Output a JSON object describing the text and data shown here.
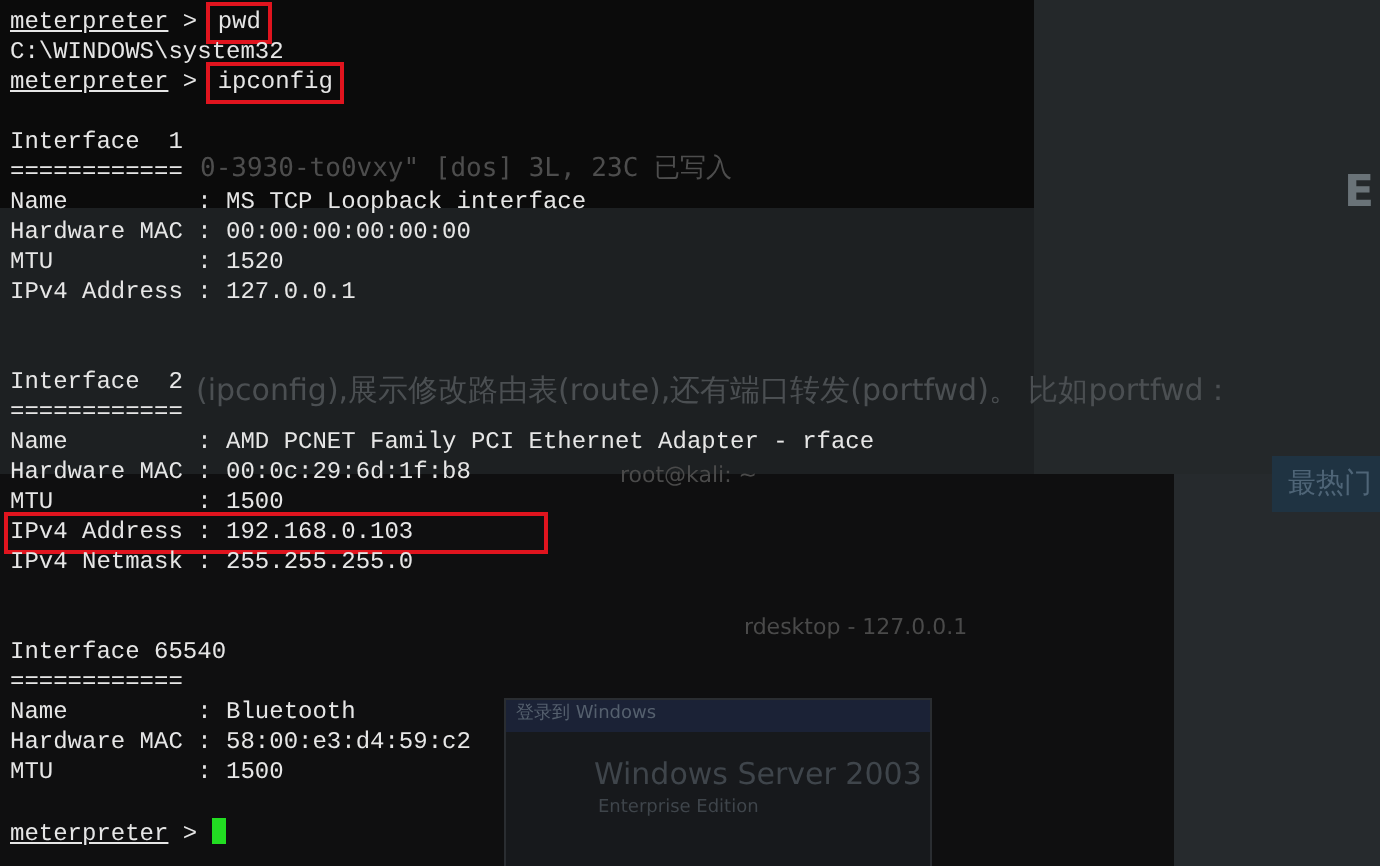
{
  "background": {
    "vim_status": "0-3930-to0vxy\" [dos] 3L, 23C 已写入",
    "side_letter": "E",
    "article_text": "(ipconfig),展示修改路由表(route),还有端口转发(portfwd)。 比如portfwd：",
    "side_button": "最热门",
    "terminal_title": "root@kali: ~",
    "rdesktop_title": "rdesktop - 127.0.0.1",
    "dialog_title": "登录到 Windows",
    "dialog_product": "Windows Server 2003",
    "dialog_edition": "Enterprise Edition"
  },
  "terminal": {
    "lines": [
      {
        "kind": "prompt",
        "prompt": "meterpreter",
        "separator": ">",
        "command": "pwd",
        "highlighted": true
      },
      {
        "kind": "output",
        "text": "C:\\WINDOWS\\system32",
        "highlighted": false
      },
      {
        "kind": "prompt",
        "prompt": "meterpreter",
        "separator": ">",
        "command": "ipconfig",
        "highlighted": true
      },
      {
        "kind": "blank"
      },
      {
        "kind": "output",
        "text": "Interface  1",
        "highlighted": false
      },
      {
        "kind": "output",
        "text": "============",
        "highlighted": false
      },
      {
        "kind": "output",
        "text": "Name         : MS TCP Loopback interface",
        "highlighted": false
      },
      {
        "kind": "output",
        "text": "Hardware MAC : 00:00:00:00:00:00",
        "highlighted": false
      },
      {
        "kind": "output",
        "text": "MTU          : 1520",
        "highlighted": false
      },
      {
        "kind": "output",
        "text": "IPv4 Address : 127.0.0.1",
        "highlighted": false
      },
      {
        "kind": "blank"
      },
      {
        "kind": "blank"
      },
      {
        "kind": "output",
        "text": "Interface  2",
        "highlighted": false
      },
      {
        "kind": "output",
        "text": "============",
        "highlighted": false
      },
      {
        "kind": "output",
        "text": "Name         : AMD PCNET Family PCI Ethernet Adapter - rface",
        "highlighted": false
      },
      {
        "kind": "output",
        "text": "Hardware MAC : 00:0c:29:6d:1f:b8",
        "highlighted": false
      },
      {
        "kind": "output",
        "text": "MTU          : 1500",
        "highlighted": false
      },
      {
        "kind": "output",
        "text": "IPv4 Address : 192.168.0.103",
        "highlighted": true
      },
      {
        "kind": "output",
        "text": "IPv4 Netmask : 255.255.255.0",
        "highlighted": false
      },
      {
        "kind": "blank"
      },
      {
        "kind": "blank"
      },
      {
        "kind": "output",
        "text": "Interface 65540",
        "highlighted": false
      },
      {
        "kind": "output",
        "text": "============",
        "highlighted": false
      },
      {
        "kind": "output",
        "text": "Name         : Bluetooth",
        "highlighted": false
      },
      {
        "kind": "output",
        "text": "Hardware MAC : 58:00:e3:d4:59:c2",
        "highlighted": false
      },
      {
        "kind": "output",
        "text": "MTU          : 1500",
        "highlighted": false
      },
      {
        "kind": "blank"
      },
      {
        "kind": "prompt",
        "prompt": "meterpreter",
        "separator": ">",
        "cursor": true
      }
    ]
  }
}
